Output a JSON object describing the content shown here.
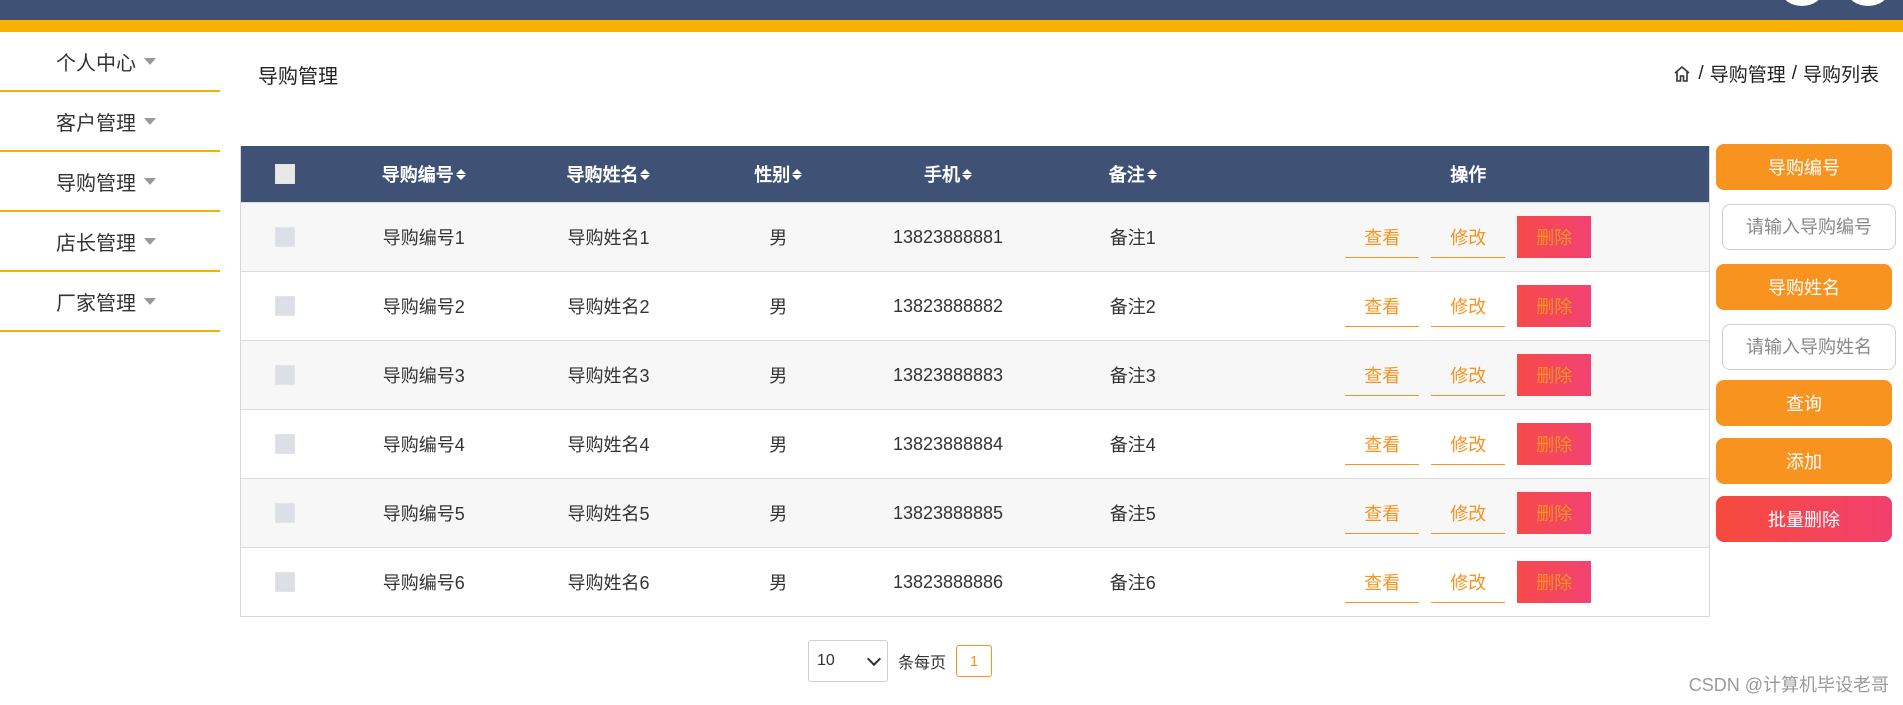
{
  "sidebar": {
    "items": [
      {
        "label": "个人中心"
      },
      {
        "label": "客户管理"
      },
      {
        "label": "导购管理"
      },
      {
        "label": "店长管理"
      },
      {
        "label": "厂家管理"
      }
    ]
  },
  "header": {
    "title": "导购管理",
    "breadcrumb": [
      "导购管理",
      "导购列表"
    ],
    "breadcrumb_sep": "/"
  },
  "table": {
    "columns": [
      "导购编号",
      "导购姓名",
      "性别",
      "手机",
      "备注",
      "操作"
    ],
    "rows": [
      {
        "no": "导购编号1",
        "name": "导购姓名1",
        "sex": "男",
        "phone": "13823888881",
        "note": "备注1"
      },
      {
        "no": "导购编号2",
        "name": "导购姓名2",
        "sex": "男",
        "phone": "13823888882",
        "note": "备注2"
      },
      {
        "no": "导购编号3",
        "name": "导购姓名3",
        "sex": "男",
        "phone": "13823888883",
        "note": "备注3"
      },
      {
        "no": "导购编号4",
        "name": "导购姓名4",
        "sex": "男",
        "phone": "13823888884",
        "note": "备注4"
      },
      {
        "no": "导购编号5",
        "name": "导购姓名5",
        "sex": "男",
        "phone": "13823888885",
        "note": "备注5"
      },
      {
        "no": "导购编号6",
        "name": "导购姓名6",
        "sex": "男",
        "phone": "13823888886",
        "note": "备注6"
      }
    ],
    "actions": {
      "view": "查看",
      "edit": "修改",
      "delete": "删除"
    }
  },
  "search": {
    "no_label": "导购编号",
    "no_placeholder": "请输入导购编号",
    "name_label": "导购姓名",
    "name_placeholder": "请输入导购姓名",
    "query_label": "查询",
    "add_label": "添加",
    "batch_delete_label": "批量删除"
  },
  "pagination": {
    "page_size": "10",
    "per_page_text": "条每页",
    "current_page": "1"
  },
  "watermark": "CSDN @计算机毕设老哥",
  "colors": {
    "header": "#3f5175",
    "accent": "#f7b100",
    "orange": "#f7931e",
    "danger": "#f74a4a"
  }
}
